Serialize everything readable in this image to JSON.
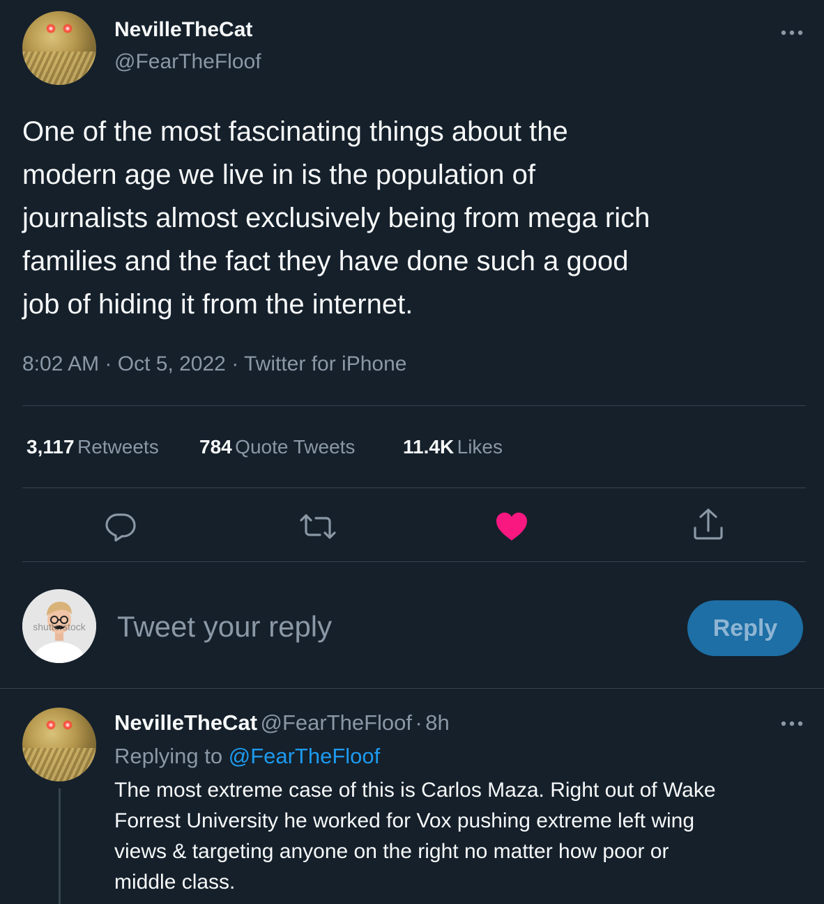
{
  "tweet": {
    "author_name": "NevilleTheCat",
    "author_handle": "@FearTheFloof",
    "text_lines": [
      "One of the most fascinating things about the",
      "modern age we live in is the population of",
      "journalists almost exclusively being from mega rich",
      "families and the fact they have done such a good",
      "job of hiding it from the internet."
    ],
    "time": "8:02 AM",
    "date": "Oct 5, 2022",
    "source": "Twitter for iPhone",
    "separator": "·",
    "more_icon": "more-horizontal-icon"
  },
  "stats": {
    "retweets_count": "3,117",
    "retweets_label": "Retweets",
    "quotes_count": "784",
    "quotes_label": "Quote Tweets",
    "likes_count": "11.4K",
    "likes_label": "Likes"
  },
  "actions": {
    "reply_icon": "comment-icon",
    "retweet_icon": "retweet-icon",
    "like_icon": "heart-filled-icon",
    "share_icon": "share-icon",
    "like_color": "#f91880"
  },
  "composer": {
    "placeholder": "Tweet your reply",
    "button_label": "Reply",
    "avatar_watermark": "shutterstock"
  },
  "reply": {
    "author_name": "NevilleTheCat",
    "author_handle": "@FearTheFloof",
    "age": "8h",
    "separator": "·",
    "replying_prefix": "Replying to",
    "replying_mention": "@FearTheFloof",
    "text_lines": [
      "The most extreme case of this is Carlos Maza. Right out of Wake",
      "Forrest University he worked for Vox pushing extreme left wing",
      "views & targeting anyone on the right no matter how poor or",
      "middle class."
    ]
  },
  "colors": {
    "background": "#15202b",
    "text": "#f7f9f9",
    "secondary": "#8b98a5",
    "divider": "#38444d",
    "accent": "#1d9bf0",
    "reply_button": "#1d6fa5"
  }
}
